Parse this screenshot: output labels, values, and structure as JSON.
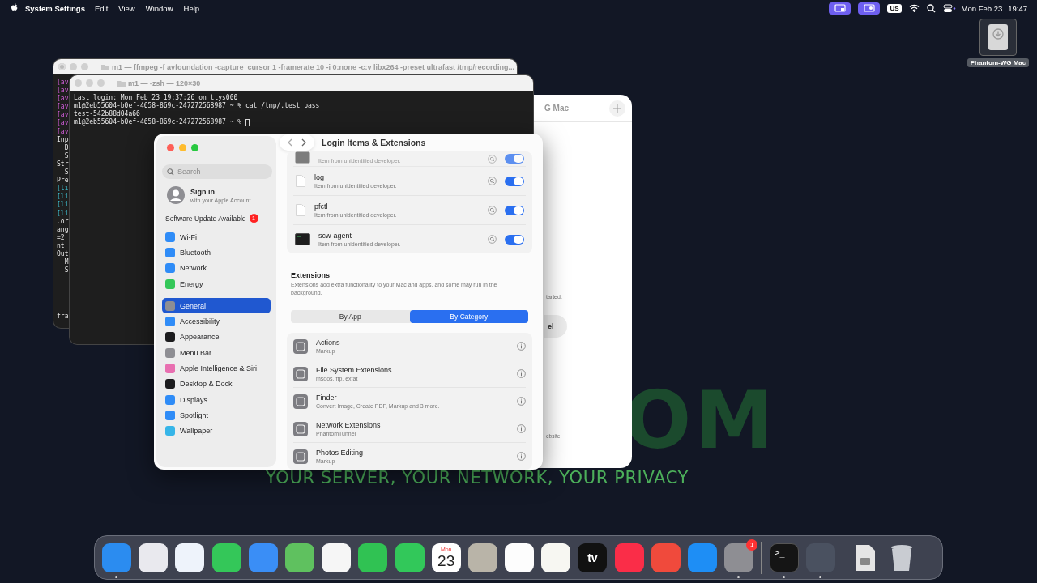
{
  "menu_bar": {
    "app_name": "System Settings",
    "menus": [
      "Edit",
      "View",
      "Window",
      "Help"
    ],
    "keyboard": "US",
    "date": "Mon Feb 23",
    "time": "19:47"
  },
  "desktop_icon": {
    "label": "Phantom-WG Mac"
  },
  "wallpaper": {
    "logo_text": "OM",
    "tagline": "YOUR SERVER, YOUR NETWORK, YOUR PRIVACY"
  },
  "phantom_window": {
    "title": "G Mac",
    "note": "tarted.",
    "button": "el",
    "link": "ebsite"
  },
  "terminal_back": {
    "title": "m1 — ffmpeg -f avfoundation -capture_cursor 1 -framerate 10 -i 0:none -c:v libx264 -preset ultrafast /tmp/recording...",
    "lines": [
      {
        "text": "[av",
        "kind": "ffmpeg"
      },
      {
        "text": "[av",
        "kind": "ffmpeg"
      },
      {
        "text": "[av",
        "kind": "ffmpeg"
      },
      {
        "text": "[av",
        "kind": "ffmpeg"
      },
      {
        "text": "[av",
        "kind": "ffmpeg"
      },
      {
        "text": "[av",
        "kind": "ffmpeg"
      },
      {
        "text": "[av",
        "kind": "ffmpeg"
      },
      {
        "text": "Inp",
        "kind": "text"
      },
      {
        "text": "  D",
        "kind": "text"
      },
      {
        "text": "  S",
        "kind": "text"
      },
      {
        "text": "Str",
        "kind": "text"
      },
      {
        "text": "  S",
        "kind": "text"
      },
      {
        "text": "Pre",
        "kind": "text"
      },
      {
        "text": "[li",
        "kind": "lib"
      },
      {
        "text": "[li",
        "kind": "lib"
      },
      {
        "text": "[li",
        "kind": "lib"
      },
      {
        "text": "[li",
        "kind": "lib"
      },
      {
        "text": ".or",
        "kind": "text"
      },
      {
        "text": "ang",
        "kind": "text"
      },
      {
        "text": "=2",
        "kind": "text"
      },
      {
        "text": "nt_",
        "kind": "text"
      },
      {
        "text": "Out",
        "kind": "text"
      },
      {
        "text": "  M",
        "kind": "text"
      },
      {
        "text": "  S",
        "kind": "text"
      }
    ],
    "last_line": "fra"
  },
  "terminal_front": {
    "title": "m1 — -zsh — 120×30",
    "lines": [
      "Last login: Mon Feb 23 19:37:26 on ttys000",
      "m1@2eb55604-b0ef-4658-869c-247272568987 ~ % cat /tmp/.test_pass",
      "test-542b88d04a66",
      "m1@2eb55604-b0ef-4658-869c-247272568987 ~ % "
    ],
    "cursor": true
  },
  "settings": {
    "search": {
      "placeholder": "Search"
    },
    "account": {
      "title": "Sign in",
      "subtitle": "with your Apple Account"
    },
    "update": {
      "label": "Software Update Available",
      "badge": "1"
    },
    "sidebar_groups": [
      [
        {
          "label": "Wi-Fi",
          "color": "#2f8cf7",
          "selected": false
        },
        {
          "label": "Bluetooth",
          "color": "#2f8cf7",
          "selected": false
        },
        {
          "label": "Network",
          "color": "#2f8cf7",
          "selected": false
        },
        {
          "label": "Energy",
          "color": "#34c759",
          "selected": false
        }
      ],
      [
        {
          "label": "General",
          "color": "#8e8e93",
          "selected": true
        },
        {
          "label": "Accessibility",
          "color": "#2f8cf7",
          "selected": false
        },
        {
          "label": "Appearance",
          "color": "#1c1c1e",
          "selected": false
        },
        {
          "label": "Menu Bar",
          "color": "#8e8e93",
          "selected": false
        },
        {
          "label": "Apple Intelligence & Siri",
          "color": "#e86fb0",
          "selected": false
        },
        {
          "label": "Desktop & Dock",
          "color": "#1c1c1e",
          "selected": false
        },
        {
          "label": "Displays",
          "color": "#2f8cf7",
          "selected": false
        },
        {
          "label": "Spotlight",
          "color": "#2f8cf7",
          "selected": false
        },
        {
          "label": "Wallpaper",
          "color": "#36b5e8",
          "selected": false
        }
      ]
    ],
    "title": "Login Items & Extensions",
    "login_items": [
      {
        "kind": "app",
        "subtitle": "Item from unidentified developer.",
        "on": true,
        "dimmed": true
      },
      {
        "kind": "file",
        "name": "log",
        "subtitle": "Item from unidentified developer.",
        "on": true,
        "dimmed": false
      },
      {
        "kind": "file",
        "name": "pfctl",
        "subtitle": "Item from unidentified developer.",
        "on": true,
        "dimmed": false
      },
      {
        "kind": "terminal",
        "name": "scw-agent",
        "subtitle": "Item from unidentified developer.",
        "on": true,
        "dimmed": false
      }
    ],
    "extensions": {
      "heading": "Extensions",
      "description": "Extensions add extra functionality to your Mac and apps, and some may run in the background.",
      "segments": [
        {
          "label": "By App",
          "selected": false
        },
        {
          "label": "By Category",
          "selected": true
        }
      ],
      "items": [
        {
          "name": "Actions",
          "detail": "Markup"
        },
        {
          "name": "File System Extensions",
          "detail": "msdos, ftp, exfat"
        },
        {
          "name": "Finder",
          "detail": "Convert Image, Create PDF, Markup and 3 more."
        },
        {
          "name": "Network Extensions",
          "detail": "PhantomTunnel"
        },
        {
          "name": "Photos Editing",
          "detail": "Markup"
        }
      ]
    }
  },
  "dock": [
    {
      "kind": "app",
      "color": "#2b8cf0",
      "running": true
    },
    {
      "kind": "app",
      "color": "#e9e9ee",
      "running": false
    },
    {
      "kind": "app",
      "color": "#eef3fb",
      "running": false
    },
    {
      "kind": "app",
      "color": "#34c759",
      "running": false
    },
    {
      "kind": "app",
      "color": "#3a8ef6",
      "running": false
    },
    {
      "kind": "app",
      "color": "#5fc15f",
      "running": false
    },
    {
      "kind": "app",
      "color": "#f6f6f6",
      "running": false
    },
    {
      "kind": "app",
      "color": "#30c253",
      "running": false
    },
    {
      "kind": "app",
      "color": "#32c85a",
      "running": false
    },
    {
      "kind": "calendar",
      "color": "#ffffff",
      "running": false,
      "day": "Mon",
      "date": "23"
    },
    {
      "kind": "app",
      "color": "#b9b4a8",
      "running": false
    },
    {
      "kind": "app",
      "color": "#fdfdfd",
      "running": false
    },
    {
      "kind": "app",
      "color": "#f7f7f2",
      "running": false
    },
    {
      "kind": "tv",
      "color": "#111111",
      "running": false,
      "label": "tv"
    },
    {
      "kind": "app",
      "color": "#fa2d48",
      "running": false
    },
    {
      "kind": "app",
      "color": "#f04a3c",
      "running": false
    },
    {
      "kind": "app",
      "color": "#1e8ef5",
      "running": false
    },
    {
      "kind": "app",
      "color": "#8e8e93",
      "running": true,
      "badge": "1"
    },
    {
      "kind": "separator"
    },
    {
      "kind": "terminal",
      "color": "#151515",
      "running": true,
      "label": ">_"
    },
    {
      "kind": "app",
      "color": "#4a5160",
      "running": true
    },
    {
      "kind": "separator"
    },
    {
      "kind": "file",
      "color": "#e5e5e5",
      "running": false
    },
    {
      "kind": "trash",
      "color": "#c9ccd2",
      "running": false
    }
  ]
}
